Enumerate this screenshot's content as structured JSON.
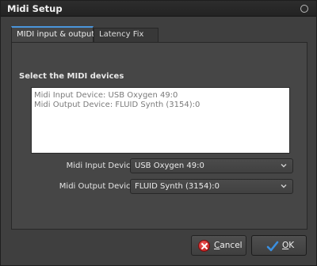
{
  "window": {
    "title": "Midi Setup"
  },
  "tabs": [
    {
      "label": "MIDI input & output",
      "active": true
    },
    {
      "label": "Latency Fix",
      "active": false
    }
  ],
  "panel": {
    "section_label": "Select the MIDI devices",
    "info_lines": [
      "Midi Input Device: USB Oxygen 49:0",
      "Midi Output Device: FLUID Synth (3154):0"
    ],
    "input_device": {
      "label": "Midi Input Device:",
      "value": "USB Oxygen 49:0"
    },
    "output_device": {
      "label": "Midi Output Device:",
      "value": "FLUID Synth (3154):0"
    }
  },
  "buttons": {
    "cancel": {
      "mnemonic": "C",
      "rest": "ancel"
    },
    "ok": {
      "mnemonic": "O",
      "rest": "K"
    }
  },
  "colors": {
    "accent": "#4a95db",
    "cancel_icon": "#d32020",
    "ok_icon": "#3a8fe0"
  },
  "icons": {
    "close": "circle-close-icon",
    "cancel": "cancel-icon",
    "ok": "checkmark-icon",
    "dropdown": "chevron-down-icon"
  }
}
